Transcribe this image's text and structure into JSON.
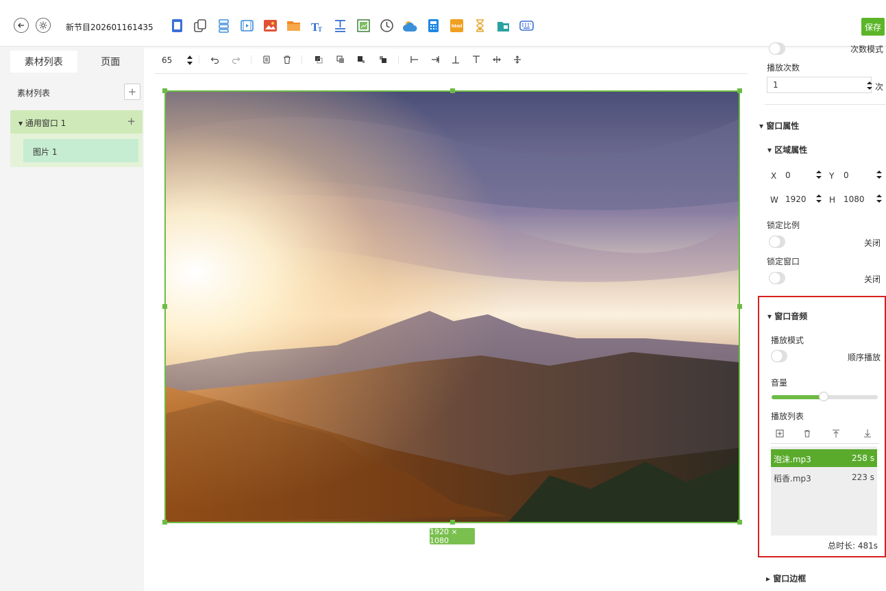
{
  "topbar": {
    "program_title": "新节目202601161435",
    "save_label": "保存",
    "tools": [
      {
        "icon": "page-icon",
        "color": "#3b6fd6"
      },
      {
        "icon": "copy-icon",
        "color": "#555555"
      },
      {
        "icon": "list-icon",
        "color": "#3b8cdc"
      },
      {
        "icon": "video-icon",
        "color": "#3b8cdc"
      },
      {
        "icon": "image-icon",
        "color": "#e05236"
      },
      {
        "icon": "folder-icon",
        "color": "#f08a24"
      },
      {
        "icon": "text-icon",
        "color": "#2e6bd1"
      },
      {
        "icon": "multiline-text-icon",
        "color": "#2e6bd1"
      },
      {
        "icon": "table-icon",
        "color": "#3a7f3a"
      },
      {
        "icon": "clock-icon",
        "color": "#444444"
      },
      {
        "icon": "weather-icon",
        "color": "#3a8fd9"
      },
      {
        "icon": "calculator-icon",
        "color": "#1e88e5"
      },
      {
        "icon": "html-icon",
        "color": "#f0a020"
      },
      {
        "icon": "hourglass-icon",
        "color": "#e8a634"
      },
      {
        "icon": "file-icon",
        "color": "#2aa3a0"
      },
      {
        "icon": "keyboard-icon",
        "color": "#3b6fd6"
      }
    ]
  },
  "left_panel": {
    "tabs": [
      "素材列表",
      "页面"
    ],
    "active_tab": 0,
    "list_title": "素材列表",
    "window_name": "▾ 通用窗口 1",
    "picture_name": "图片 1"
  },
  "edit_toolbar": {
    "zoom": "65"
  },
  "canvas": {
    "dimension_label": "1920 × 1080"
  },
  "right_panel": {
    "loop_mode_label": "次数模式",
    "play_count_label": "播放次数",
    "play_count_value": "1",
    "play_count_unit": "次",
    "window_props_title": "▾ 窗口属性",
    "region_props_title": "▾ 区域属性",
    "x_label": "X",
    "x_value": "0",
    "y_label": "Y",
    "y_value": "0",
    "w_label": "W",
    "w_value": "1920",
    "h_label": "H",
    "h_value": "1080",
    "lock_ratio_label": "锁定比例",
    "lock_ratio_state": "关闭",
    "lock_window_label": "锁定窗口",
    "lock_window_state": "关闭",
    "audio": {
      "title": "▾ 窗口音频",
      "play_mode_label": "播放模式",
      "play_mode_state": "顺序播放",
      "volume_label": "音量",
      "volume_level": 0.49,
      "playlist_label": "播放列表",
      "playlist": [
        {
          "name": "泡沫.mp3",
          "duration": "258 s",
          "selected": true
        },
        {
          "name": "稻香.mp3",
          "duration": "223 s",
          "selected": false
        }
      ],
      "total_label": "总时长: 481s"
    },
    "window_border_title": "▸ 窗口边框"
  }
}
